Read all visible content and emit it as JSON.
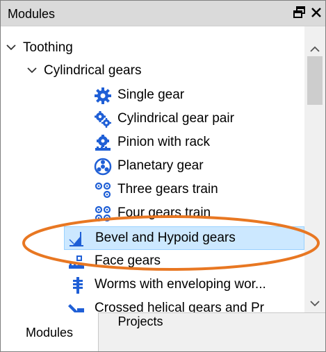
{
  "panel": {
    "title": "Modules",
    "float_icon": "float-window-icon",
    "close_icon": "close-icon"
  },
  "tree": {
    "root": {
      "label": "Toothing",
      "expanded": true
    },
    "group": {
      "label": "Cylindrical gears",
      "expanded": true
    },
    "cylindrical_items": [
      {
        "label": "Single gear",
        "icon": "single-gear-icon"
      },
      {
        "label": "Cylindrical gear pair",
        "icon": "gear-pair-icon"
      },
      {
        "label": "Pinion with rack",
        "icon": "pinion-rack-icon"
      },
      {
        "label": "Planetary gear",
        "icon": "planetary-gear-icon"
      },
      {
        "label": "Three gears train",
        "icon": "three-gears-icon"
      },
      {
        "label": "Four gears train",
        "icon": "four-gears-icon"
      }
    ],
    "other_items": [
      {
        "label": "Bevel and Hypoid gears",
        "icon": "bevel-gear-icon",
        "selected": true
      },
      {
        "label": "Face gears",
        "icon": "face-gear-icon"
      },
      {
        "label": "Worms with enveloping wor...",
        "icon": "worm-gear-icon"
      },
      {
        "label": "Crossed helical gears and Pr",
        "icon": "crossed-helical-icon"
      }
    ]
  },
  "tabs": [
    {
      "label": "Modules",
      "active": true
    },
    {
      "label": "Projects",
      "active": false
    }
  ],
  "colors": {
    "titlebar_bg": "#dadada",
    "icon_blue": "#1f5fd6",
    "selection_bg": "#cce8ff",
    "selection_border": "#99d1ff",
    "annotation_orange": "#e87722"
  }
}
